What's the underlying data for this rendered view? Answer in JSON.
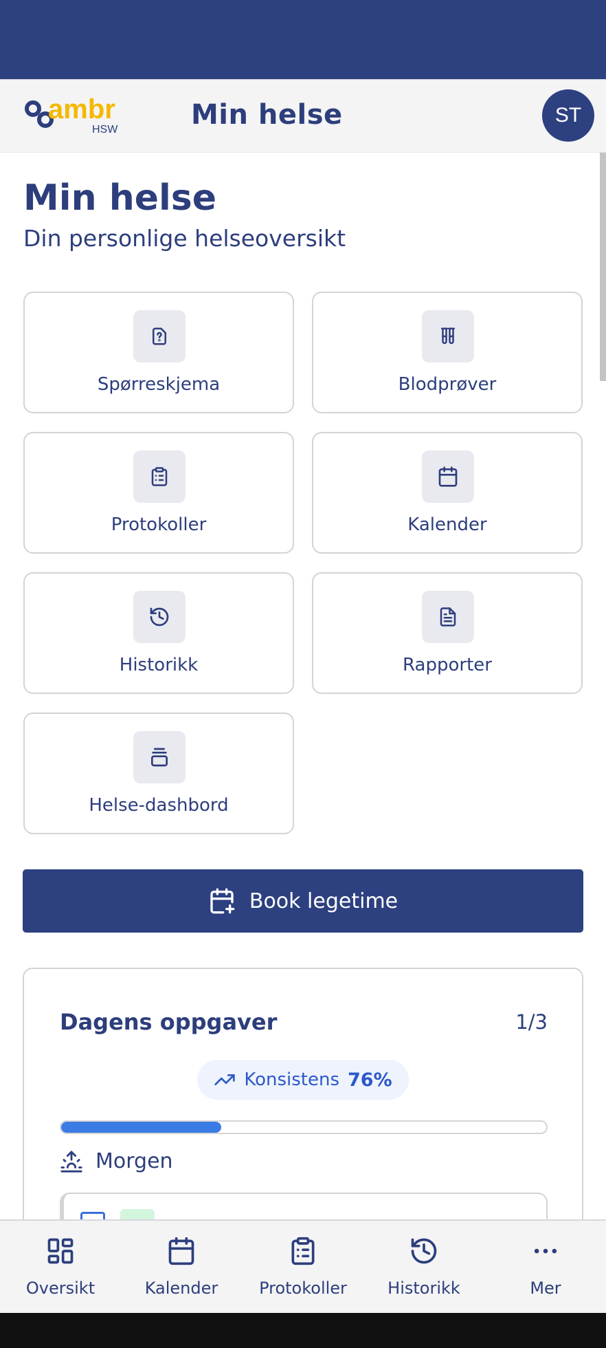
{
  "header": {
    "logo_text": "ambr",
    "logo_subtext": "HSW",
    "title": "Min helse",
    "avatar_initials": "ST"
  },
  "page": {
    "title": "Min helse",
    "subtitle": "Din personlige helseoversikt"
  },
  "tiles": [
    {
      "label": "Spørreskjema",
      "icon": "question-file-icon"
    },
    {
      "label": "Blodprøver",
      "icon": "test-tubes-icon"
    },
    {
      "label": "Protokoller",
      "icon": "clipboard-list-icon"
    },
    {
      "label": "Kalender",
      "icon": "calendar-icon"
    },
    {
      "label": "Historikk",
      "icon": "history-icon"
    },
    {
      "label": "Rapporter",
      "icon": "document-icon"
    },
    {
      "label": "Helse-dashbord",
      "icon": "layers-icon"
    }
  ],
  "book_button": {
    "label": "Book legetime",
    "icon": "calendar-plus-icon"
  },
  "tasks": {
    "title": "Dagens oppgaver",
    "count": "1/3",
    "consistency_label": "Konsistens",
    "consistency_value": "76%",
    "progress_fraction": 0.33,
    "section_label": "Morgen"
  },
  "bottom_nav": [
    {
      "label": "Oversikt",
      "icon": "grid-icon"
    },
    {
      "label": "Kalender",
      "icon": "calendar-icon"
    },
    {
      "label": "Protokoller",
      "icon": "clipboard-list-icon"
    },
    {
      "label": "Historikk",
      "icon": "history-icon"
    },
    {
      "label": "Mer",
      "icon": "more-icon"
    }
  ],
  "colors": {
    "brand": "#2d4080",
    "accent": "#3b7be4",
    "logo_yellow": "#f5b800",
    "tile_icon_bg": "#e9e9f0"
  }
}
